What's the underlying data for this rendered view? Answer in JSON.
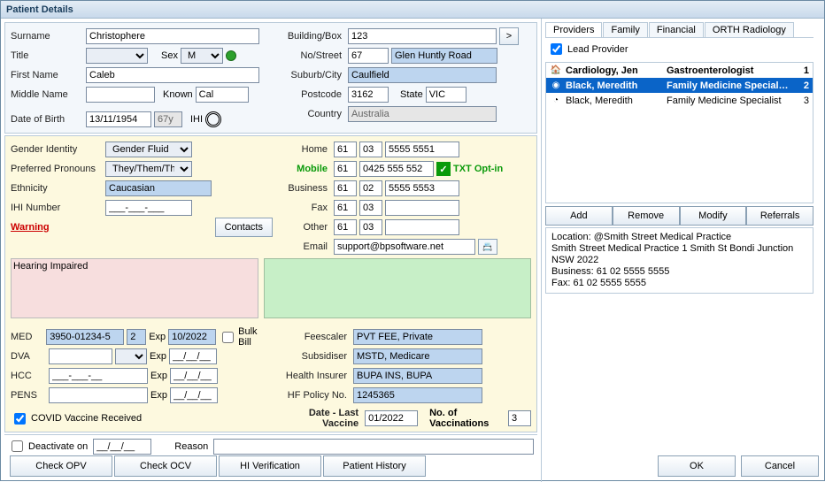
{
  "window_title": "Patient Details",
  "labels": {
    "surname": "Surname",
    "title": "Title",
    "sex": "Sex",
    "first_name": "First Name",
    "middle_name": "Middle Name",
    "known": "Known",
    "dob": "Date of Birth",
    "age_suffix": "67y",
    "ihi_lbl": "IHI",
    "building": "Building/Box",
    "nostreet": "No/Street",
    "suburb": "Suburb/City",
    "postcode": "Postcode",
    "state": "State",
    "country": "Country",
    "gender_identity": "Gender Identity",
    "pronouns": "Preferred Pronouns",
    "ethnicity": "Ethnicity",
    "ihi_number": "IHI Number",
    "warning": "Warning",
    "contacts_btn": "Contacts",
    "home": "Home",
    "mobile": "Mobile",
    "business": "Business",
    "fax": "Fax",
    "other": "Other",
    "email": "Email",
    "txt_opt": "TXT Opt-in",
    "med": "MED",
    "dva": "DVA",
    "hcc": "HCC",
    "pens": "PENS",
    "exp": "Exp",
    "bulk_bill": "Bulk Bill",
    "feescaler": "Feescaler",
    "subsidiser": "Subsidiser",
    "health_ins": "Health Insurer",
    "hf_policy": "HF Policy No.",
    "covid": "COVID Vaccine Received",
    "last_vac": "Date - Last Vaccine",
    "num_vac": "No. of Vaccinations",
    "deactivate": "Deactivate on",
    "reason": "Reason",
    "check_opv": "Check OPV",
    "check_ocv": "Check OCV",
    "hi_ver": "HI Verification",
    "pat_hist": "Patient History",
    "ok": "OK",
    "cancel": "Cancel",
    "lead_provider": "Lead Provider",
    "add": "Add",
    "remove": "Remove",
    "modify": "Modify",
    "referrals": "Referrals"
  },
  "name": {
    "surname": "Christophere",
    "title": "",
    "sex": "M",
    "first": "Caleb",
    "middle": "",
    "known": "Cal",
    "dob": "13/11/1954"
  },
  "addr": {
    "building": "123",
    "no": "67",
    "street": "Glen Huntly Road",
    "city": "Caulfield",
    "postcode": "3162",
    "state": "VIC",
    "country": "Australia"
  },
  "demo": {
    "gender_identity": "Gender Fluid",
    "pronouns": "They/Them/Their",
    "ethnicity": "Caucasian",
    "ihi_number": "___-___-___"
  },
  "warning_text": "Hearing Impaired",
  "phones": {
    "home_cc": "61",
    "home_ac": "03",
    "home_num": "5555 5551",
    "mob_cc": "61",
    "mob_num": "0425 555 552",
    "bus_cc": "61",
    "bus_ac": "02",
    "bus_num": "5555 5553",
    "fax_cc": "61",
    "fax_ac": "03",
    "fax_num": "",
    "oth_cc": "61",
    "oth_ac": "03",
    "oth_num": ""
  },
  "email": "support@bpsoftware.net",
  "ins": {
    "med": "3950-01234-5",
    "med_ref": "2",
    "med_exp": "10/2022",
    "dva": "",
    "dva_exp": "__/__/__",
    "hcc": "___-___-__",
    "hcc_exp": "__/__/__",
    "pens": "",
    "pens_exp": "__/__/__",
    "feescaler": "PVT FEE, Private",
    "subsidiser": "MSTD, Medicare",
    "health_ins": "BUPA INS, BUPA",
    "hf_policy": "1245365",
    "last_vac": "01/2022",
    "num_vac": "3"
  },
  "deact": {
    "date": "__/__/__",
    "reason": ""
  },
  "tabs": [
    "Providers",
    "Family",
    "Financial",
    "ORTH Radiology"
  ],
  "providers": [
    {
      "icon": "🏠",
      "name": "Cardiology, Jen",
      "type": "Gastroenterologist",
      "num": "1",
      "bold": true,
      "sel": false
    },
    {
      "icon": "◉",
      "name": "Black, Meredith",
      "type": "Family Medicine Special…",
      "num": "2",
      "bold": true,
      "sel": true
    },
    {
      "icon": "◔",
      "name": "Black, Meredith",
      "type": "Family Medicine Specialist",
      "num": "3",
      "bold": false,
      "sel": false
    }
  ],
  "location": {
    "l1": "Location: @Smith Street Medical Practice",
    "l2": "Smith Street Medical Practice 1 Smith St Bondi Junction NSW 2022",
    "l3": "Business: 61 02 5555 5555",
    "l4": "Fax: 61 02 5555 5555"
  }
}
